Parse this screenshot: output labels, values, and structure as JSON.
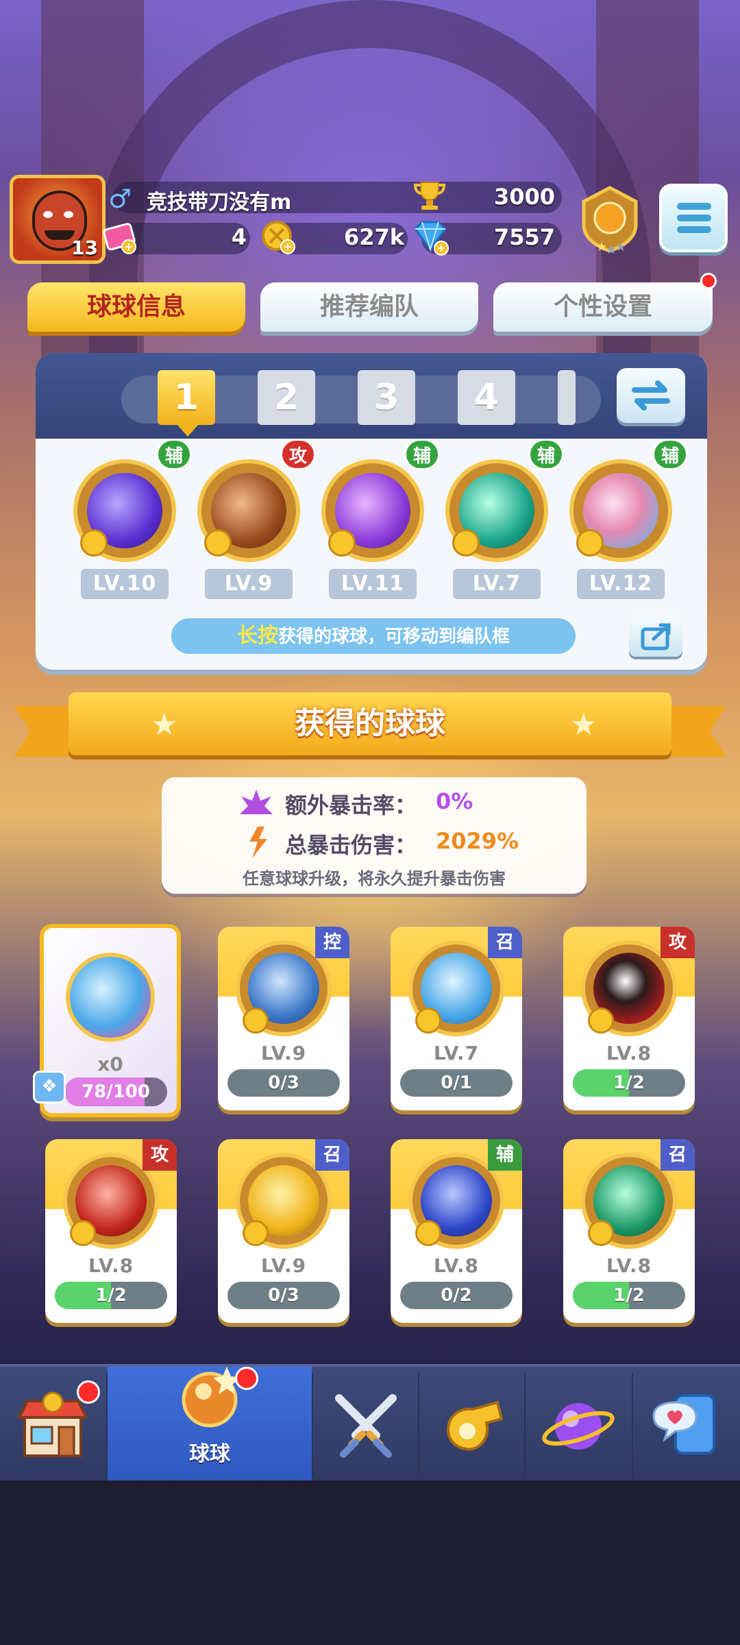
{
  "player": {
    "level": "13",
    "name": "竞技带刀没有m",
    "trophies": "3000",
    "tickets": "4",
    "coins": "627k",
    "gems": "7557"
  },
  "icons": {
    "gender": "male-icon",
    "trophy": "trophy-icon",
    "ticket": "ticket-icon",
    "coin": "coin-icon",
    "gem": "gem-icon",
    "menu": "hamburger-menu-icon",
    "swap": "swap-icon",
    "share": "share-icon"
  },
  "tabs": [
    {
      "label": "球球信息",
      "active": true
    },
    {
      "label": "推荐编队",
      "active": false
    },
    {
      "label": "个性设置",
      "active": false
    }
  ],
  "team_slots": [
    "1",
    "2",
    "3",
    "4"
  ],
  "team_balls": [
    {
      "tag": "辅",
      "level": "LV.10",
      "tag_color": "#35a33f"
    },
    {
      "tag": "攻",
      "level": "LV.9",
      "tag_color": "#d4302a"
    },
    {
      "tag": "辅",
      "level": "LV.11",
      "tag_color": "#35a33f"
    },
    {
      "tag": "辅",
      "level": "LV.7",
      "tag_color": "#35a33f"
    },
    {
      "tag": "辅",
      "level": "LV.12",
      "tag_color": "#35a33f"
    }
  ],
  "hint": {
    "highlight": "长按",
    "text": "获得的球球，可移动到编队框"
  },
  "section_title": "获得的球球",
  "crit": {
    "extra_rate_label": "额外暴击率：",
    "extra_rate_value": "0%",
    "total_damage_label": "总暴击伤害：",
    "total_damage_value": "2029%",
    "note": "任意球球升级，将永久提升暴击伤害"
  },
  "special_ball": {
    "count": "x0",
    "progress": "78/100",
    "fraction": 0.78
  },
  "owned_balls": [
    {
      "tag": "控",
      "level": "LV.9",
      "progress": "0/3",
      "fraction": 0.0
    },
    {
      "tag": "召",
      "level": "LV.7",
      "progress": "0/1",
      "fraction": 0.0
    },
    {
      "tag": "攻",
      "level": "LV.8",
      "progress": "1/2",
      "fraction": 0.5
    },
    {
      "tag": "攻",
      "level": "LV.8",
      "progress": "1/2",
      "fraction": 0.5
    },
    {
      "tag": "召",
      "level": "LV.9",
      "progress": "0/3",
      "fraction": 0.0
    },
    {
      "tag": "辅",
      "level": "LV.8",
      "progress": "0/2",
      "fraction": 0.0
    },
    {
      "tag": "召",
      "level": "LV.8",
      "progress": "1/2",
      "fraction": 0.5
    }
  ],
  "nav": [
    {
      "label": "",
      "icon": "shop-icon"
    },
    {
      "label": "球球",
      "icon": "ball-icon",
      "active": true
    },
    {
      "label": "",
      "icon": "crossed-swords-icon"
    },
    {
      "label": "",
      "icon": "whistle-icon"
    },
    {
      "label": "",
      "icon": "planet-icon"
    },
    {
      "label": "",
      "icon": "chat-heart-icon"
    }
  ]
}
